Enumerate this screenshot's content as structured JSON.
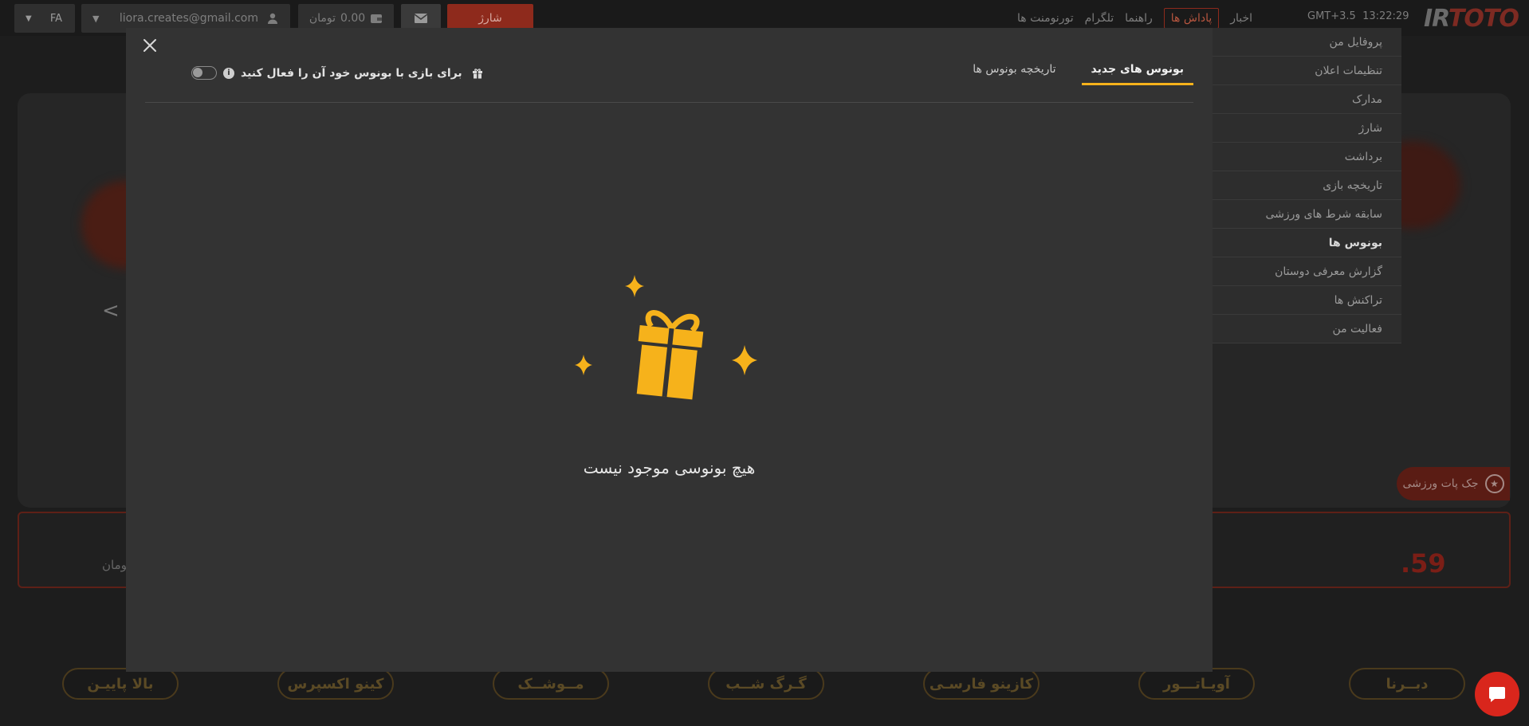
{
  "topbar": {
    "lang": "FA",
    "email": "liora.creates@gmail.com",
    "balance": "0.00",
    "currency": "تومان",
    "charge_label": "شارژ",
    "nav": {
      "tournaments": "تورنومنت ها",
      "telegram": "تلگرام",
      "guide": "راهنما",
      "rewards": "پاداش ها",
      "news": "اخبار"
    },
    "time": "13:22:29",
    "timezone": "GMT+3.5",
    "logo_ir": "IR",
    "logo_toto": "TOTO"
  },
  "account_menu": {
    "items": [
      {
        "label": "پروفایل من"
      },
      {
        "label": "تنظیمات اعلان"
      },
      {
        "label": "مدارک"
      },
      {
        "label": "شارژ"
      },
      {
        "label": "برداشت"
      },
      {
        "label": "تاریخچه بازی"
      },
      {
        "label": "سابقه شرط های ورزشی"
      },
      {
        "label": "بونوس ها"
      },
      {
        "label": "گزارش معرفی دوستان"
      },
      {
        "label": "تراکنش ها"
      },
      {
        "label": "فعالیت من"
      }
    ],
    "active_index": 7
  },
  "modal": {
    "tabs": [
      {
        "label": "بونوس های جدید"
      },
      {
        "label": "تاریخچه بونوس ها"
      }
    ],
    "toggle_label": "برای بازی با بونوس خود آن را فعال کنید",
    "toggle_on": false,
    "empty_message": "هیچ بونوسی موجود نیست"
  },
  "background": {
    "jackpot_value": ".59",
    "jackpot_unit": "تومان",
    "sport_jackpot_label": "جک پات ورزشی",
    "games": [
      "بالا پاییـن",
      "کینو اکسپرس",
      "مــوشــک",
      "گـرگ شــب",
      "کازینو فارسـی",
      "آویـاتـــور",
      "دبــرنا"
    ]
  },
  "colors": {
    "accent": "#f6b21b",
    "brand_red": "#d9261c",
    "modal_bg": "#333333"
  }
}
